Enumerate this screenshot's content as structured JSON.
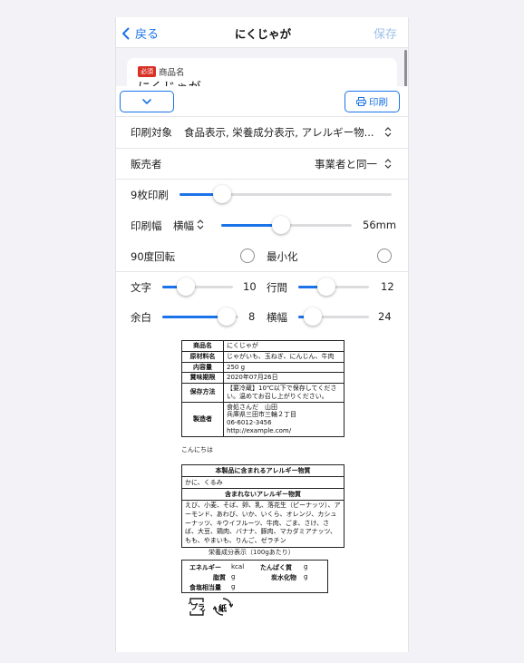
{
  "nav": {
    "back": "戻る",
    "title": "にくじゃが",
    "save": "保存"
  },
  "behind": {
    "required": "必須",
    "field_label": "商品名",
    "field_value": "にくじゃが"
  },
  "toolbar": {
    "print": "印刷"
  },
  "settings": {
    "print_target_label": "印刷対象",
    "print_target_value": "食品表示, 栄養成分表示, アレルギー物...",
    "seller_label": "販売者",
    "seller_value": "事業者と同一",
    "sheets_label": "9枚印刷",
    "sheets_slider": 0.2,
    "width_label": "印刷幅",
    "width_mode": "横幅",
    "width_value": "56mm",
    "width_slider": 0.46,
    "rotate_label": "90度回転",
    "minimize_label": "最小化",
    "font_label": "文字",
    "font_value": "10",
    "font_slider": 0.33,
    "line_label": "行間",
    "line_value": "12",
    "line_slider": 0.4,
    "margin_label": "余白",
    "margin_value": "8",
    "margin_slider": 0.84,
    "hwidth_label": "横幅",
    "hwidth_value": "24",
    "hwidth_slider": 0.2
  },
  "label": {
    "rows": [
      {
        "k": "商品名",
        "v": "にくじゃが"
      },
      {
        "k": "原材料名",
        "v": "じゃがいも、玉ねぎ、にんじん、牛肉"
      },
      {
        "k": "内容量",
        "v": "250 g"
      },
      {
        "k": "賞味期限",
        "v": "2020年07月26日"
      },
      {
        "k": "保存方法",
        "v": "【要冷蔵】10℃以下で保存してください。温めてお召し上がりください。"
      }
    ],
    "maker_key": "製造者",
    "maker_lines": [
      "食処さんだ　山田",
      "兵庫県三田市三輪２丁目",
      "06-6012-3456",
      "http://example.com/"
    ],
    "note": "こんにちは"
  },
  "allergy": {
    "contains_title": "本製品に含まれるアレルギー物質",
    "contains": "かに、くるみ",
    "not_title": "含まれないアレルギー物質",
    "not_list": "えび、小麦、そば、卵、乳、落花生（ピーナッツ）、アーモンド、あわび、いか、いくら、オレンジ、カシューナッツ、キウイフルーツ、牛肉、ごま、さけ、さば、大豆、鶏肉、バナナ、豚肉、マカダミアナッツ、もも、やまいも、りんご、ゼラチン"
  },
  "nutrition": {
    "title": "栄養成分表示（100gあたり）",
    "energy": "エネルギー",
    "energy_unit": "kcal",
    "protein": "たんぱく質",
    "protein_unit": "g",
    "fat": "脂質",
    "fat_unit": "g",
    "carb": "炭水化物",
    "carb_unit": "g",
    "salt": "食塩相当量",
    "salt_unit": "g"
  },
  "recycle": {
    "plastic": "プラ",
    "paper": "紙"
  },
  "colors": {
    "accent": "#1a73e8",
    "required": "#d93025"
  }
}
